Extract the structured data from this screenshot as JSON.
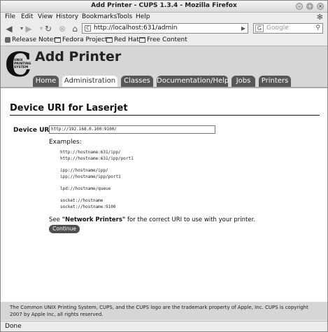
{
  "window": {
    "title": "Add Printer - CUPS 1.3.4 - Mozilla Firefox"
  },
  "menu": [
    "File",
    "Edit",
    "View",
    "History",
    "Bookmarks",
    "Tools",
    "Help"
  ],
  "toolbar": {
    "back": "back-icon",
    "forward": "forward-icon",
    "reload": "reload-icon",
    "stop": "stop-icon",
    "home": "home-icon",
    "url": "http://localhost:631/admin",
    "search_engine": "G",
    "search_placeholder": "Google"
  },
  "bookmarks": [
    {
      "label": "Release Notes",
      "icon": "rss-icon"
    },
    {
      "label": "Fedora Project",
      "icon": "folder-icon"
    },
    {
      "label": "Red Hat",
      "icon": "folder-icon"
    },
    {
      "label": "Free Content",
      "icon": "folder-icon"
    }
  ],
  "page": {
    "logo_text": "UNIX PRINTING SYSTEM",
    "title": "Add Printer",
    "tabs": [
      {
        "label": "Home",
        "active": false
      },
      {
        "label": "Administration",
        "active": true
      },
      {
        "label": "Classes",
        "active": false
      },
      {
        "label": "Documentation/Help",
        "active": false
      },
      {
        "label": "Jobs",
        "active": false
      },
      {
        "label": "Printers",
        "active": false
      }
    ],
    "section_title": "Device URI for Laserjet",
    "uri_label": "Device URI:",
    "uri_value": "http://192.168.0.100:9100/",
    "examples_label": "Examples:",
    "examples": [
      "http://hostname:631/ipp/",
      "http://hostname:631/ipp/port1",
      "ipp://hostname/ipp/",
      "ipp://hostname/ipp/port1",
      "lpd://hostname/queue",
      "socket://hostname",
      "socket://hostname:9100"
    ],
    "see_prefix": "See ",
    "see_link": "\"Network Printers\"",
    "see_suffix": " for the correct URI to use with your printer.",
    "continue_label": "Continue",
    "footer": "The Common UNIX Printing System, CUPS, and the CUPS logo are the trademark property of Apple, Inc. CUPS is copyright 2007 by Apple Inc, all rights reserved."
  },
  "status": "Done",
  "colors": {
    "header_gray": "#d6d6d6",
    "tab_dark": "#575757",
    "button_dark": "#4f4f4f"
  }
}
